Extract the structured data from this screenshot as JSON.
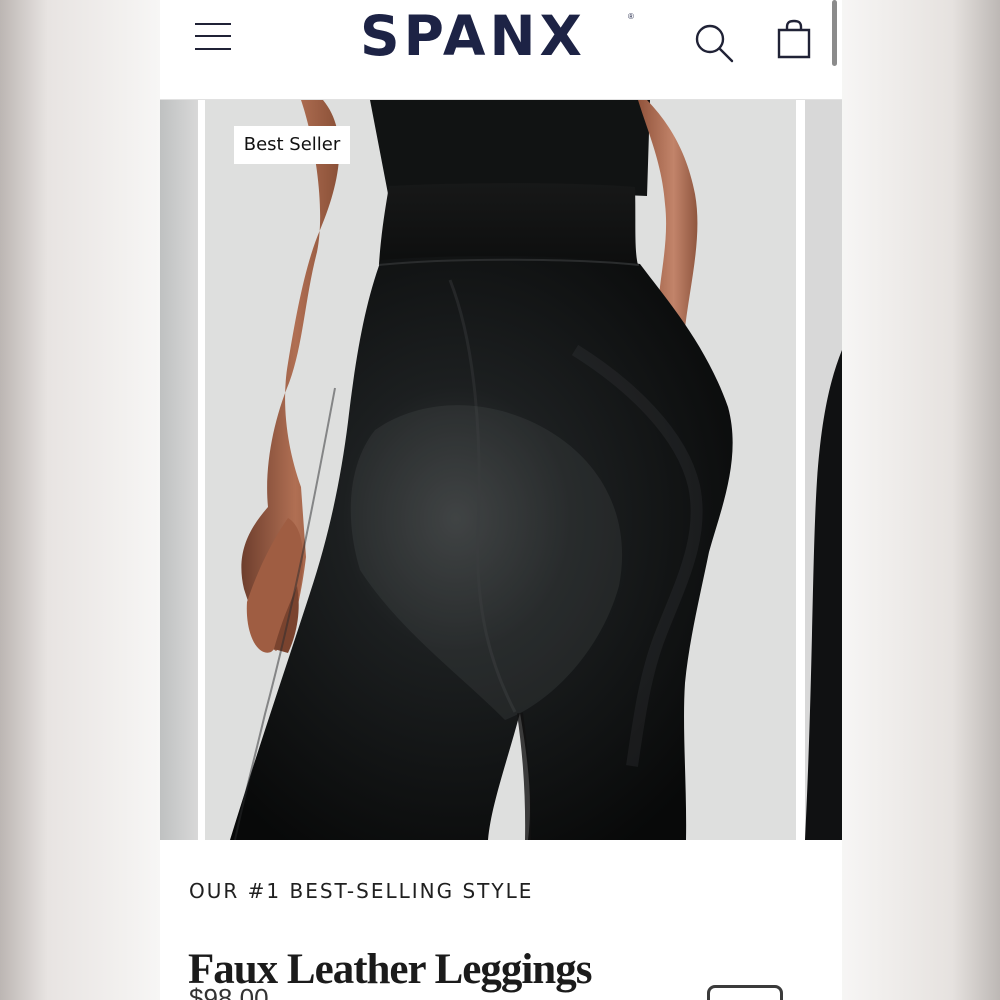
{
  "brand": {
    "name": "SPANX",
    "registered": "®"
  },
  "header": {
    "menu_icon": "hamburger-menu-icon",
    "search_icon": "search-icon",
    "bag_icon": "shopping-bag-icon"
  },
  "product": {
    "badge": "Best Seller",
    "eyebrow": "OUR #1 BEST-SELLING STYLE",
    "title": "Faux Leather Leggings",
    "price": "$98.00"
  },
  "colors": {
    "brand_navy": "#1d2345",
    "text_dark": "#1b1b1b",
    "image_bg": "#dcdddc",
    "legging_black": "#111111"
  }
}
